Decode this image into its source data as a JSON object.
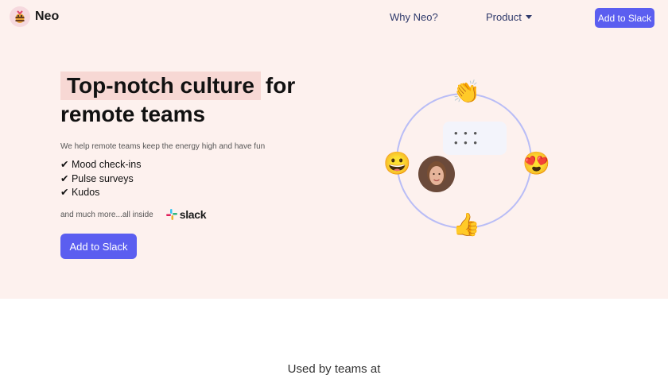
{
  "nav": {
    "brand": "Neo",
    "links": [
      "Why Neo?",
      "Product"
    ],
    "cta": "Add to Slack"
  },
  "hero": {
    "headline_highlight": "Top-notch culture",
    "headline_after": "for",
    "headline_line2": "remote teams",
    "subtitle": "We help remote teams keep the energy high and have fun",
    "features": [
      "✔ Mood check-ins",
      "✔ Pulse surveys",
      "✔ Kudos"
    ],
    "more_text": "and much more...all inside",
    "slack_word": "slack",
    "cta": "Add to Slack"
  },
  "illustration": {
    "emojis": [
      "👏",
      "😀",
      "😍",
      "👍"
    ],
    "typing_dots": "• • •\n• • •"
  },
  "section2": {
    "title": "Used by teams at"
  },
  "colors": {
    "accent": "#5b5ef0",
    "hero_bg": "#fdf1ee",
    "highlight": "#f7d8d4",
    "ring": "#b9bdf6"
  }
}
